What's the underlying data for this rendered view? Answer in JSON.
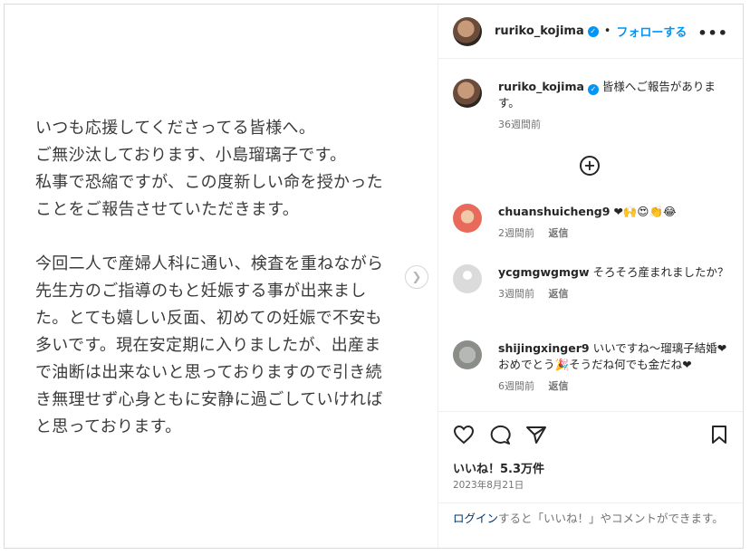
{
  "media": {
    "paragraph1": "いつも応援してくださってる皆様へ。\nご無沙汰しております、小島瑠璃子です。\n私事で恐縮ですが、この度新しい命を授かった\nことをご報告させていただきます。",
    "paragraph2": "今回二人で産婦人科に通い、検査を重ねながら\n先生方のご指導のもと妊娠する事が出来まし\nた。とても嬉しい反面、初めての妊娠で不安も\n多いです。現在安定期に入りましたが、出産ま\nで油断は出来ないと思っておりますので引き続\nき無理せず心身ともに安静に過ごしていければ\nと思っております。",
    "next_icon": "chevron-right-icon"
  },
  "header": {
    "username": "ruriko_kojima",
    "dot": "•",
    "follow_label": "フォローする",
    "more_label": "•••"
  },
  "caption": {
    "username": "ruriko_kojima",
    "text": "皆様へご報告があります。",
    "time": "36週間前"
  },
  "load_more_icon": "plus-circle-icon",
  "comments": [
    {
      "username": "chuanshuicheng9",
      "text": "❤🙌😍👏😂",
      "time": "2週間前",
      "reply": "返信"
    },
    {
      "username": "ycgmgwgmgw",
      "text": "そろそろ産まれましたか？",
      "time": "3週間前",
      "reply": "返信"
    },
    {
      "username": "shijingxinger9",
      "text": "いいですね～瑠璃子結婚❤おめでとう🎉そうだね何でも金だね❤",
      "time": "6週間前",
      "reply": "返信"
    }
  ],
  "actions": {
    "likes": "いいね！5.3万件",
    "date": "2023年8月21日"
  },
  "login_prompt": {
    "link": "ログイン",
    "text": "すると「いいね！」やコメントができます。"
  },
  "colors": {
    "accent": "#0095f6",
    "link": "#00376b",
    "muted": "#737373"
  }
}
